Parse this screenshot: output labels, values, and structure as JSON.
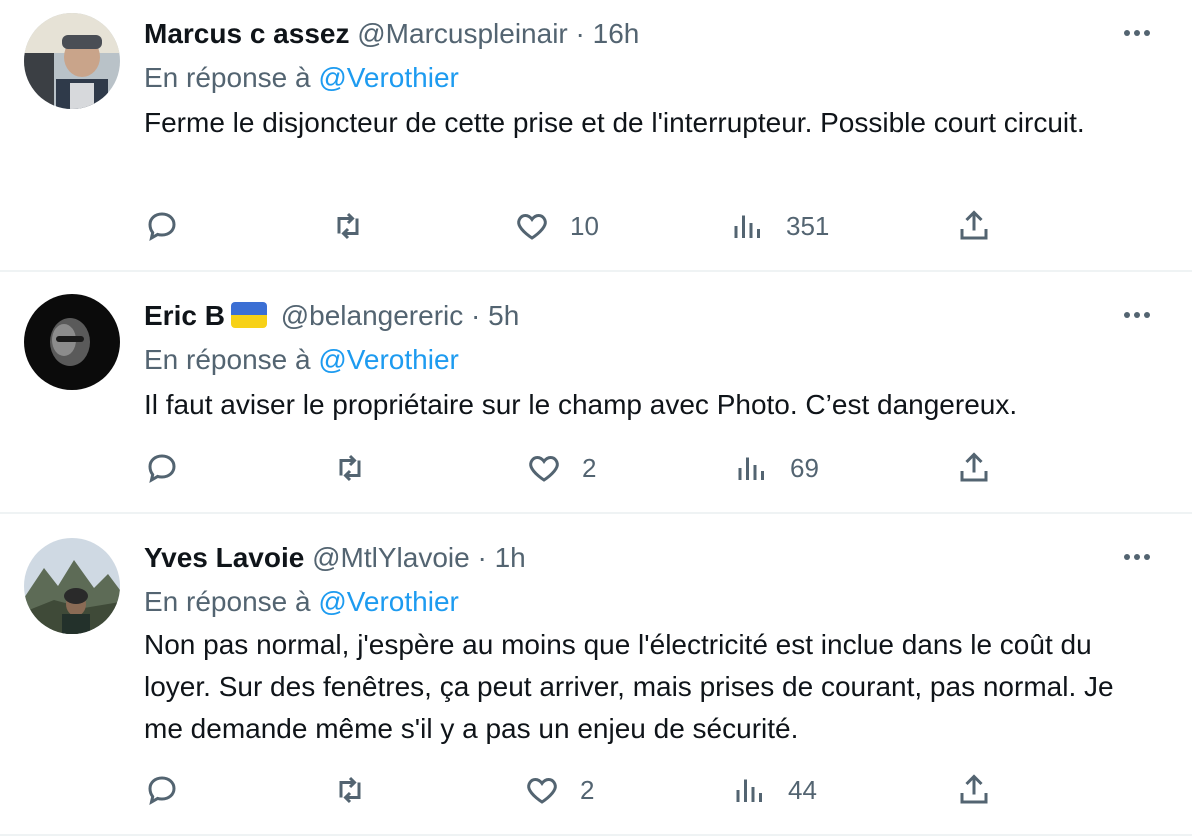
{
  "tweets": [
    {
      "name": "Marcus c assez",
      "handle": "@Marcuspleinair",
      "separator": "·",
      "time": "16h",
      "reply_prefix": "En réponse à",
      "reply_to": "@Verothier",
      "text": "Ferme le disjoncteur de cette prise et de l'interrupteur.  Possible court circuit.",
      "likes": "10",
      "views": "351",
      "has_flag": false
    },
    {
      "name": "Eric B",
      "handle": "@belangereric",
      "separator": "·",
      "time": "5h",
      "reply_prefix": "En réponse à",
      "reply_to": "@Verothier",
      "text": "Il faut aviser le propriétaire sur le champ avec Photo. C’est dangereux.",
      "likes": "2",
      "views": "69",
      "has_flag": true
    },
    {
      "name": "Yves Lavoie",
      "handle": "@MtlYlavoie",
      "separator": "·",
      "time": "1h",
      "reply_prefix": "En réponse à",
      "reply_to": "@Verothier",
      "text": "Non pas normal, j'espère au moins que l'électricité est inclue dans le coût du loyer. Sur des fenêtres, ça peut arriver, mais prises de courant, pas normal. Je me demande même s'il y a pas un enjeu de sécurité.",
      "likes": "2",
      "views": "44",
      "has_flag": false
    }
  ],
  "colors": {
    "text": "#0f1419",
    "secondary": "#536471",
    "link": "#1d9bf0",
    "divider": "#eff3f4"
  },
  "icons": [
    "reply-icon",
    "retweet-icon",
    "like-icon",
    "views-icon",
    "share-icon",
    "more-icon",
    "ukraine-flag-icon"
  ]
}
